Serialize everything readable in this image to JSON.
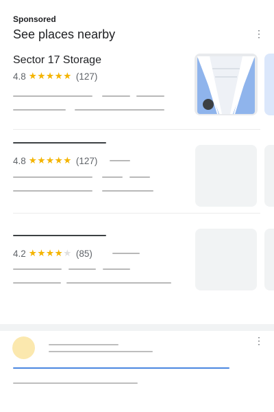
{
  "ad": {
    "sponsored_label": "Sponsored",
    "title": "See places nearby",
    "more_icon": "⋮"
  },
  "places": [
    {
      "name": "Sector 17 Storage",
      "rating": "4.8",
      "stars": 5,
      "reviews": "(127)"
    },
    {
      "name": "",
      "rating": "4.8",
      "stars": 5,
      "reviews": "(127)"
    },
    {
      "name": "",
      "rating": "4.2",
      "stars": 4,
      "reviews": "(85)"
    }
  ],
  "colors": {
    "star": "#f4b400",
    "accent_blue": "#4a86e0",
    "avatar": "#fbe8ae",
    "placeholder": "#f1f3f4"
  },
  "icons": [
    "more-vert-icon",
    "star-icon",
    "avatar-icon"
  ]
}
